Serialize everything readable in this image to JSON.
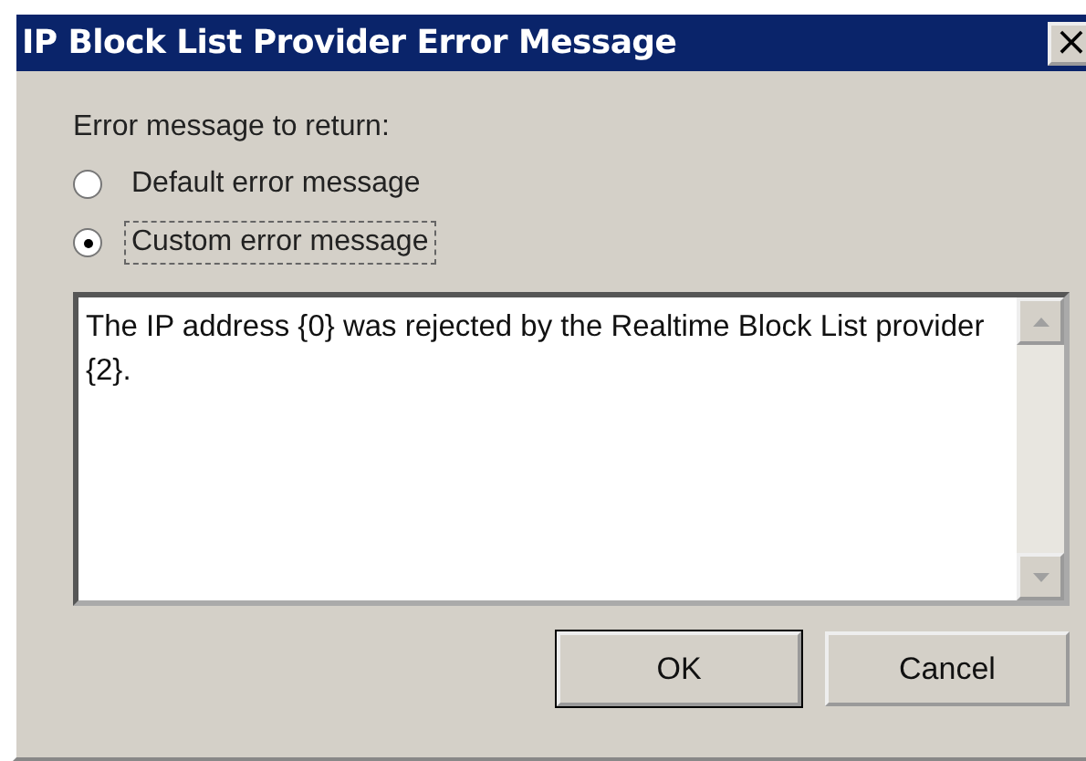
{
  "window": {
    "title": "IP Block List Provider Error Message",
    "close": "×"
  },
  "group_label": "Error message to return:",
  "options": [
    {
      "label": "Default error message",
      "selected": false
    },
    {
      "label": "Custom error message",
      "selected": true
    }
  ],
  "message": "The IP address {0} was rejected by the Realtime Block List provider {2}.",
  "buttons": [
    {
      "label": "OK",
      "default": true
    },
    {
      "label": "Cancel",
      "default": false
    }
  ]
}
